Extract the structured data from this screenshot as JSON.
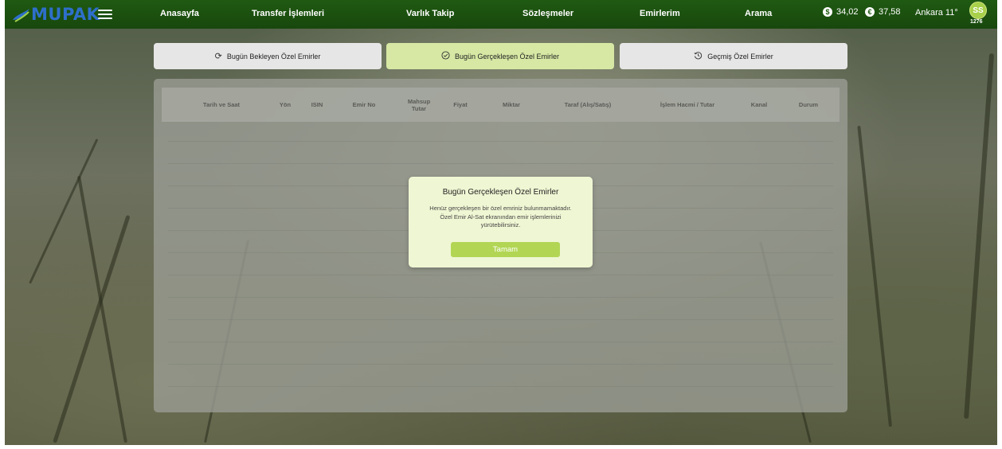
{
  "brand": {
    "name": "MUPAK"
  },
  "nav": {
    "items": [
      {
        "label": "Anasayfa"
      },
      {
        "label": "Transfer İşlemleri"
      },
      {
        "label": "Varlık Takip"
      },
      {
        "label": "Sözleşmeler"
      },
      {
        "label": "Emirlerim"
      },
      {
        "label": "Arama"
      }
    ]
  },
  "rates": [
    {
      "icon": "dollar-icon",
      "symbol": "$",
      "value": "34,02"
    },
    {
      "icon": "euro-icon",
      "symbol": "€",
      "value": "37,58"
    }
  ],
  "weather": {
    "text": "Ankara 11°"
  },
  "user": {
    "initials": "SS",
    "number": "1276"
  },
  "tabs": [
    {
      "label": "Bugün Bekleyen Özel Emirler",
      "icon": "refresh-icon"
    },
    {
      "label": "Bugün Gerçekleşen Özel Emirler",
      "icon": "check-circle-icon",
      "active": true
    },
    {
      "label": "Geçmiş Özel Emirler",
      "icon": "history-icon"
    }
  ],
  "table": {
    "columns": [
      "Tarih ve Saat",
      "Yön",
      "ISIN",
      "Emir No",
      "Mahsup Tutar",
      "Fiyat",
      "Miktar",
      "Taraf (Alış/Satış)",
      "İşlem Hacmi / Tutar",
      "Kanal",
      "Durum"
    ],
    "rows": []
  },
  "dialog": {
    "title": "Bugün Gerçekleşen Özel Emirler",
    "message": "Henüz gerçekleşen bir özel emriniz bulunmamaktadır. Özel Emir Al-Sat ekranından emir işlemlerinizi yürütebilirsiniz.",
    "button": "Tamam"
  },
  "colors": {
    "topbar": "#1f5a12",
    "active_tab": "#d6e8a4",
    "dialog_bg": "#eff6d3",
    "primary_button": "#b2d654"
  }
}
